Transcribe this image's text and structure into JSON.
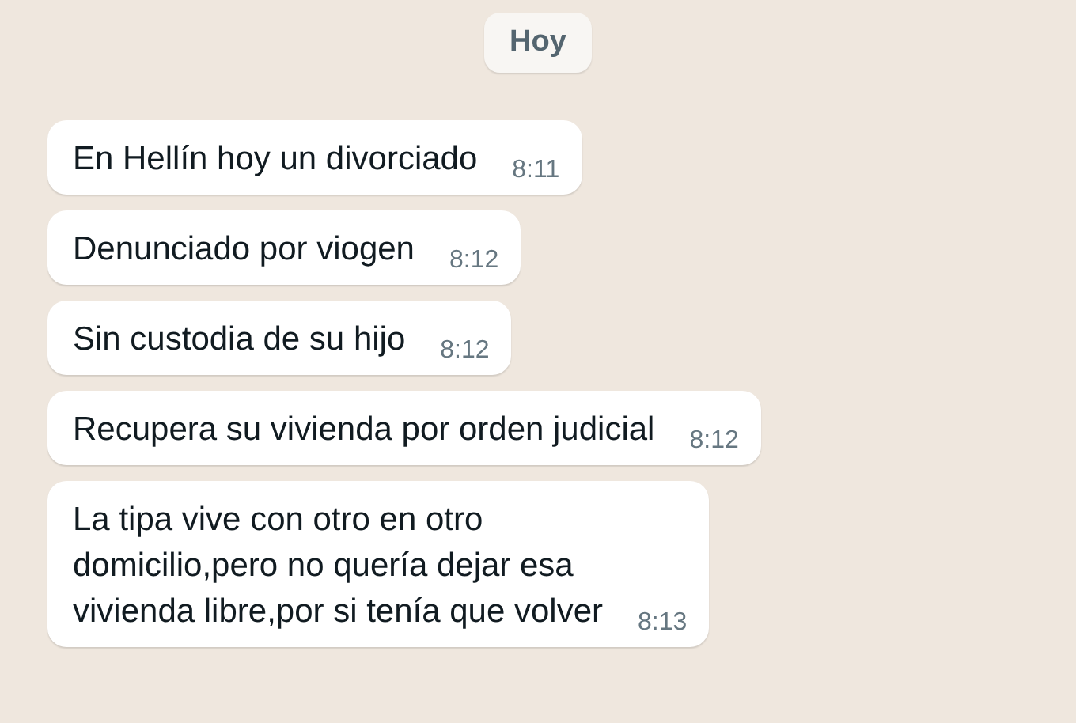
{
  "date_chip": "Hoy",
  "messages": [
    {
      "text": "En Hellín hoy un divorciado",
      "time": "8:11"
    },
    {
      "text": "Denunciado por viogen",
      "time": "8:12"
    },
    {
      "text": "Sin custodia de su hijo",
      "time": "8:12"
    },
    {
      "text": "Recupera su vivienda por orden judicial",
      "time": "8:12"
    },
    {
      "text": "La tipa vive con otro en otro\ndomicilio,pero no quería dejar esa\nvivienda libre,por si tenía que volver",
      "time": "8:13"
    }
  ]
}
